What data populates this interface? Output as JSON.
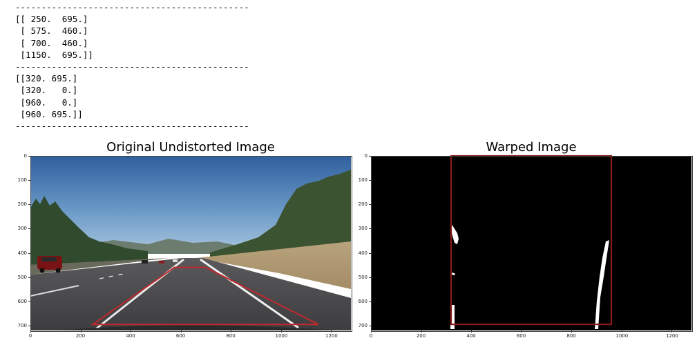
{
  "output": {
    "lines": [
      "---------------------------------------------",
      "[[ 250.  695.]",
      " [ 575.  460.]",
      " [ 700.  460.]",
      " [1150.  695.]]",
      "---------------------------------------------",
      "[[320. 695.]",
      " [320.   0.]",
      " [960.   0.]",
      " [960. 695.]]",
      "---------------------------------------------"
    ]
  },
  "chart_data": [
    {
      "type": "image",
      "title": "Original Undistorted Image",
      "xlim": [
        0,
        1280
      ],
      "ylim": [
        720,
        0
      ],
      "xticks": [
        "0",
        "200",
        "400",
        "600",
        "800",
        "1000",
        "1200"
      ],
      "yticks": [
        "0",
        "100",
        "200",
        "300",
        "400",
        "500",
        "600",
        "700"
      ],
      "overlay_polygon": [
        [
          250,
          695
        ],
        [
          575,
          460
        ],
        [
          700,
          460
        ],
        [
          1150,
          695
        ]
      ],
      "overlay_color": "#c0282d"
    },
    {
      "type": "image",
      "title": "Warped Image",
      "xlim": [
        0,
        1280
      ],
      "ylim": [
        720,
        0
      ],
      "xticks": [
        "0",
        "200",
        "400",
        "600",
        "800",
        "1000",
        "1200"
      ],
      "yticks": [
        "0",
        "100",
        "200",
        "300",
        "400",
        "500",
        "600",
        "700"
      ],
      "overlay_polygon": [
        [
          320,
          695
        ],
        [
          320,
          0
        ],
        [
          960,
          0
        ],
        [
          960,
          695
        ]
      ],
      "overlay_color": "#8b1a1a"
    }
  ]
}
